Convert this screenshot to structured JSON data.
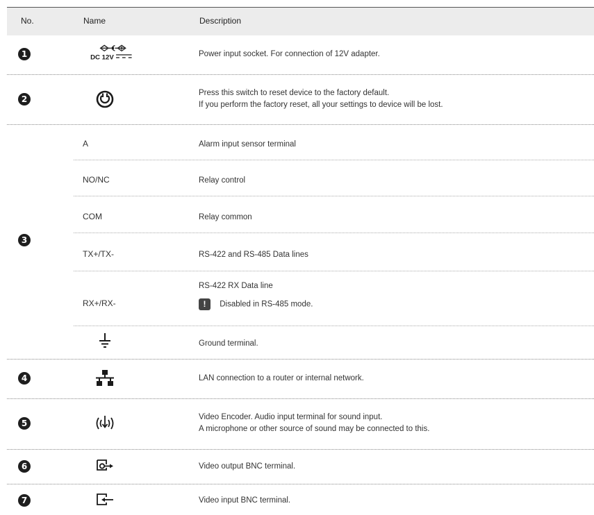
{
  "header": {
    "no": "No.",
    "name": "Name",
    "description": "Description"
  },
  "rows": [
    {
      "num": "1",
      "icon": "dc-power-icon",
      "icon_label": "DC 12V",
      "description": [
        "Power input socket. For connection of 12V adapter."
      ]
    },
    {
      "num": "2",
      "icon": "reset-switch-icon",
      "description": [
        "Press this switch to reset device to the factory default.",
        "If you perform the factory reset, all your settings to device will be lost."
      ]
    },
    {
      "num": "3",
      "sub": [
        {
          "name": "A",
          "description": [
            "Alarm input sensor terminal"
          ]
        },
        {
          "name": "NO/NC",
          "description": [
            "Relay control"
          ]
        },
        {
          "name": "COM",
          "description": [
            "Relay common"
          ]
        },
        {
          "name": "TX+/TX-",
          "description": [
            "RS-422 and RS-485 Data lines"
          ]
        },
        {
          "name": "RX+/RX-",
          "description": [
            "RS-422 RX Data line"
          ],
          "note": "Disabled in RS-485 mode."
        },
        {
          "icon": "ground-icon",
          "description": [
            "Ground terminal."
          ]
        }
      ]
    },
    {
      "num": "4",
      "icon": "lan-network-icon",
      "description": [
        "LAN connection to a router or internal network."
      ]
    },
    {
      "num": "5",
      "icon": "audio-input-icon",
      "description": [
        "Video Encoder. Audio input terminal for sound input.",
        "A microphone or other source of sound may be connected to this."
      ]
    },
    {
      "num": "6",
      "icon": "video-output-icon",
      "description": [
        "Video output BNC terminal."
      ]
    },
    {
      "num": "7",
      "icon": "video-input-icon",
      "description": [
        "Video input BNC terminal."
      ]
    }
  ],
  "note_icon": "!"
}
